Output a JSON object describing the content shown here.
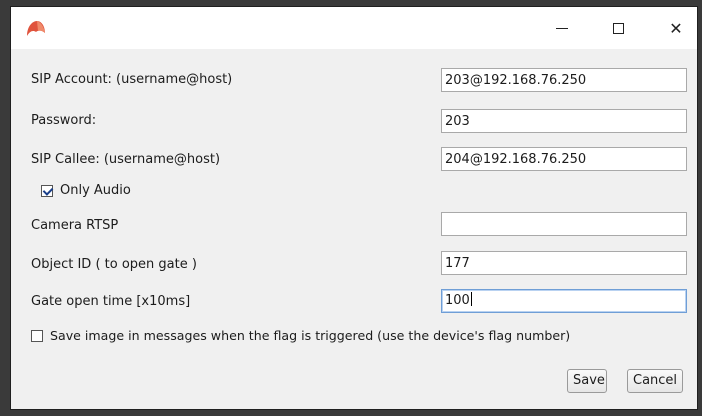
{
  "window": {
    "brand_color": "#e0533d",
    "controls": [
      "minimize-icon",
      "maximize-icon",
      "close-icon"
    ],
    "close_glyph": "✕"
  },
  "form": {
    "sip_account_label": "SIP Account: (username@host)",
    "sip_account_value": "203@192.168.76.250",
    "password_label": "Password:",
    "password_value": "203",
    "sip_callee_label": "SIP Callee: (username@host)",
    "sip_callee_value": "204@192.168.76.250",
    "only_audio_label": "Only Audio",
    "only_audio_checked": true,
    "camera_rtsp_label": "Camera RTSP",
    "camera_rtsp_value": "",
    "object_id_label": "Object ID ( to open gate )",
    "object_id_value": "177",
    "gate_time_label": "Gate open time [x10ms]",
    "gate_time_value": "100",
    "save_image_label": "Save image in messages when the flag is triggered (use the device's flag number)",
    "save_image_checked": false
  },
  "buttons": {
    "save_label": "Save",
    "cancel_label": "Cancel"
  }
}
